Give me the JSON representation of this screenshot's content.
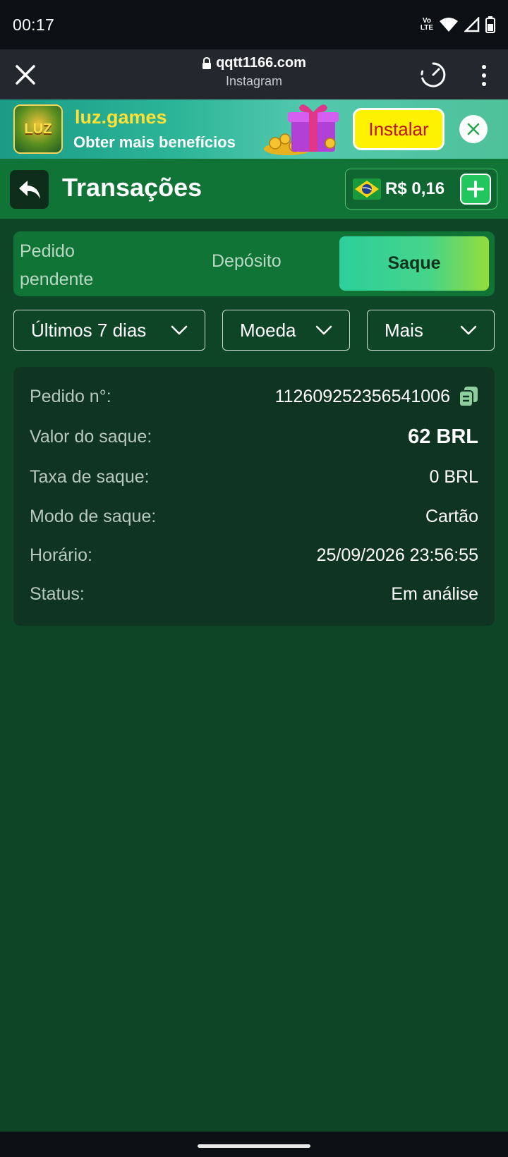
{
  "status_bar": {
    "time": "00:17",
    "network_label": "Vo LTE"
  },
  "browser": {
    "url": "qqtt1166.com",
    "source": "Instagram"
  },
  "banner": {
    "app_name": "luz.games",
    "tagline": "Obter mais benefícios",
    "install_label": "Instalar",
    "logo_text": "LUZ"
  },
  "header": {
    "title": "Transações",
    "balance": "R$ 0,16"
  },
  "tabs": {
    "pending": "Pedido pendente",
    "deposit": "Depósito",
    "withdraw": "Saque",
    "active": "withdraw"
  },
  "filters": {
    "period": "Últimos 7 dias",
    "currency": "Moeda",
    "more": "Mais"
  },
  "order": {
    "rows": [
      {
        "label": "Pedido n°:",
        "value": "112609252356541006"
      },
      {
        "label": "Valor do saque:",
        "value": "62 BRL"
      },
      {
        "label": "Taxa de saque:",
        "value": "0 BRL"
      },
      {
        "label": "Modo de saque:",
        "value": "Cartão"
      },
      {
        "label": "Horário:",
        "value": "25/09/2026 23:56:55"
      },
      {
        "label": "Status:",
        "value": "Em análise"
      }
    ]
  },
  "colors": {
    "background": "#0f4527",
    "header": "#117437",
    "accent": "#22c55e",
    "install": "#fff200"
  }
}
